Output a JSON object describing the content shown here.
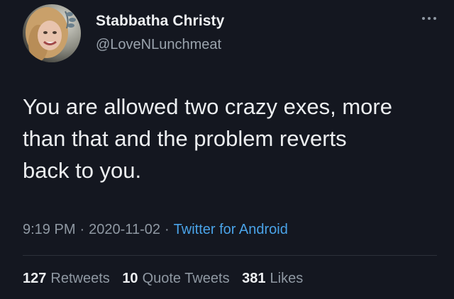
{
  "author": {
    "display_name": "Stabbatha Christy",
    "handle": "@LoveNLunchmeat"
  },
  "tweet": {
    "text": "You are allowed two crazy exes, more\nthan that and the problem reverts\nback to you.",
    "time": "9:19 PM",
    "date": "2020-11-02",
    "separator": "·",
    "source": "Twitter for Android"
  },
  "stats": {
    "retweets_count": "127",
    "retweets_label": "Retweets",
    "quote_count": "10",
    "quote_label": "Quote Tweets",
    "likes_count": "381",
    "likes_label": "Likes"
  },
  "icons": {
    "more": "more-dots-icon",
    "avatar": "profile-photo"
  },
  "colors": {
    "background": "#141720",
    "primary_text": "#eceef0",
    "secondary_text": "#8f98a2",
    "link": "#4aa3e8"
  }
}
